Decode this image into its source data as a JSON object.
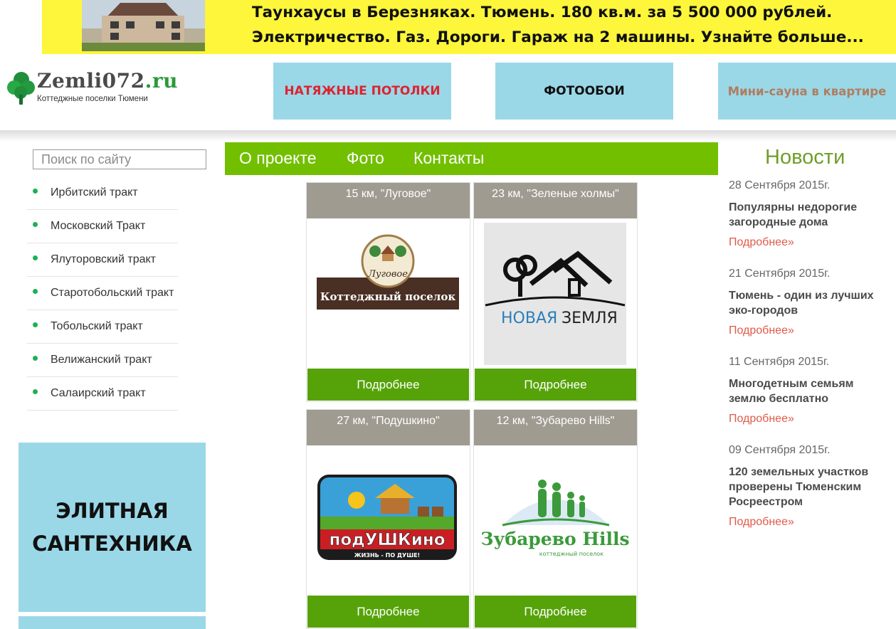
{
  "banner": {
    "line1": "Таунхаусы в Березняках. Тюмень. 180 кв.м. за 5 500 000 рублей.",
    "line2": "Электричество. Газ. Дороги. Гараж на 2 машины. Узнайте больше..."
  },
  "logo": {
    "name": "Zemli072",
    "tld": ".ru",
    "subtitle": "Коттеджные поселки Тюмени"
  },
  "header_ads": [
    "НАТЯЖНЫЕ ПОТОЛКИ",
    "ФОТООБОИ",
    "Мини-сауна в квартире"
  ],
  "search": {
    "placeholder": "Поиск по сайту"
  },
  "sidebar": {
    "items": [
      "Ирбитский тракт",
      "Московский Тракт",
      "Ялуторовский тракт",
      "Старотобольский тракт",
      "Тобольский тракт",
      "Велижанский тракт",
      "Салаирский тракт"
    ]
  },
  "side_ad": {
    "line1": "ЭЛИТНАЯ",
    "line2": "САНТЕХНИКА"
  },
  "nav": [
    "О проекте",
    "Фото",
    "Контакты"
  ],
  "cards": [
    {
      "title": "15 км, \"Луговое\"",
      "logo_text_top": "Луговое",
      "logo_text_band": "Коттеджный поселок",
      "button": "Подробнее"
    },
    {
      "title": "23 км, \"Зеленые холмы\"",
      "logo_text_blue": "НОВАЯ",
      "logo_text_dark": "ЗЕМЛЯ",
      "button": "Подробнее"
    },
    {
      "title": "27 км, \"Подушкино\"",
      "logo_text_main": "подУШКино",
      "logo_text_slogan": "ЖИЗНЬ - ПО ДУШЕ!",
      "button": "Подробнее"
    },
    {
      "title": "12 км, \"Зубарево Hills\"",
      "logo_text_main": "Зубарево Hills",
      "logo_text_sub": "коттеджный поселок",
      "button": "Подробнее"
    }
  ],
  "news": {
    "heading": "Новости",
    "items": [
      {
        "date": "28 Сентября 2015г.",
        "title": "Популярны недорогие загородные дома",
        "more": "Подробнее»"
      },
      {
        "date": "21 Сентября 2015г.",
        "title": "Тюмень - один из лучших эко-городов",
        "more": "Подробнее»"
      },
      {
        "date": "11 Сентября 2015г.",
        "title": "Многодетным семьям землю бесплатно",
        "more": "Подробнее»"
      },
      {
        "date": "09 Сентября 2015г.",
        "title": "120 земельных участков проверены Тюменским Росреестром",
        "more": "Подробнее»"
      }
    ]
  },
  "colors": {
    "nav_green": "#72bf00",
    "button_green": "#56a309",
    "ad_blue": "#9ad8e8",
    "banner_yellow": "#fdf63a",
    "link_red": "#e05a4a",
    "news_head_green": "#6e9e2a"
  }
}
